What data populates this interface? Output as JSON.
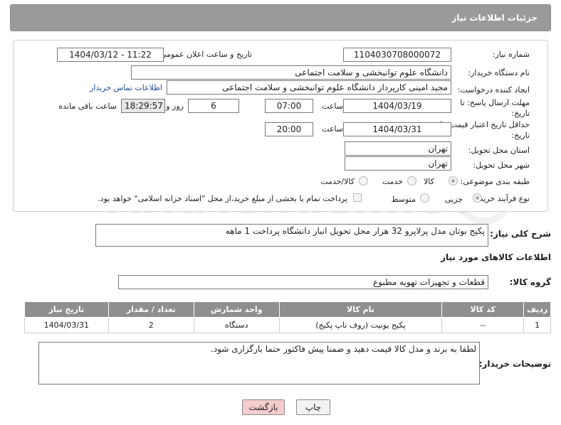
{
  "header": {
    "title": "جزئیات اطلاعات نیاز"
  },
  "form": {
    "need_number_label": "شماره نیاز:",
    "need_number": "1104030708000072",
    "announce_label": "تاریخ و ساعت اعلان عمومی:",
    "announce_value": "1404/03/12 - 11:22",
    "buyer_org_label": "نام دستگاه خریدار:",
    "buyer_org": "دانشگاه علوم توانبخشی و سلامت اجتماعی",
    "creator_label": "ایجاد کننده درخواست:",
    "creator": "مجید امینی کارپرداز دانشگاه علوم توانبخشی و سلامت اجتماعی",
    "contact_link": "اطلاعات تماس خریدار",
    "deadline_label": "مهلت ارسال پاسخ: تا تاریخ:",
    "deadline_date": "1404/03/19",
    "time_label": "ساعت",
    "deadline_time": "07:00",
    "days_value": "6",
    "days_label": "روز و",
    "remaining_time": "18:29:57",
    "remaining_label": "ساعت باقی مانده",
    "validity_label": "حداقل تاریخ اعتبار قیمت: تا تاریخ:",
    "validity_date": "1404/03/31",
    "validity_time": "20:00",
    "province_label": "استان محل تحویل:",
    "province": "تهران",
    "city_label": "شهر محل تحویل:",
    "city": "تهران",
    "category_label": "طبقه بندی موضوعی:",
    "category_options": [
      "کالا",
      "خدمت",
      "کالا/خدمت"
    ],
    "process_label": "نوع فرآیند خرید :",
    "process_options": [
      "جزیی",
      "متوسط"
    ],
    "payment_note": "پرداخت تمام یا بخشی از مبلغ خرید،از محل \"اسناد خزانه اسلامی\" خواهد بود."
  },
  "summary": {
    "label": "شرح کلی نیاز:",
    "text": "پکیج بوتان مدل پرلاپرو 32 هزار   محل تحویل انبار دانشگاه  پرداخت 1 ماهه"
  },
  "goods": {
    "section_title": "اطلاعات کالاهای مورد نیاز",
    "group_label": "گروه کالا:",
    "group_value": "قطعات و تجهیزات تهویه مطبوع",
    "columns": [
      "ردیف",
      "کد کالا",
      "نام کالا",
      "واحد شمارش",
      "تعداد / مقدار",
      "تاریخ نیاز"
    ],
    "rows": [
      [
        "1",
        "--",
        "پکیج یونیت (روف تاپ پکیج)",
        "دستگاه",
        "2",
        "1404/03/31"
      ]
    ]
  },
  "buyer_notes": {
    "label": "توضیحات خریدار:",
    "text": "لطفا به برند و مدل کالا قیمت دهید و ضمنا پیش فاکتور حتما بارگزاری شود."
  },
  "buttons": {
    "print": "چاپ",
    "back": "بازگشت"
  },
  "watermark": "AriaTender.neT",
  "colors": {
    "title_bar": "#9a9a9a",
    "table_header": "#8f8f8f",
    "link": "#1a4fa0",
    "back_button": "#f4cccc"
  }
}
